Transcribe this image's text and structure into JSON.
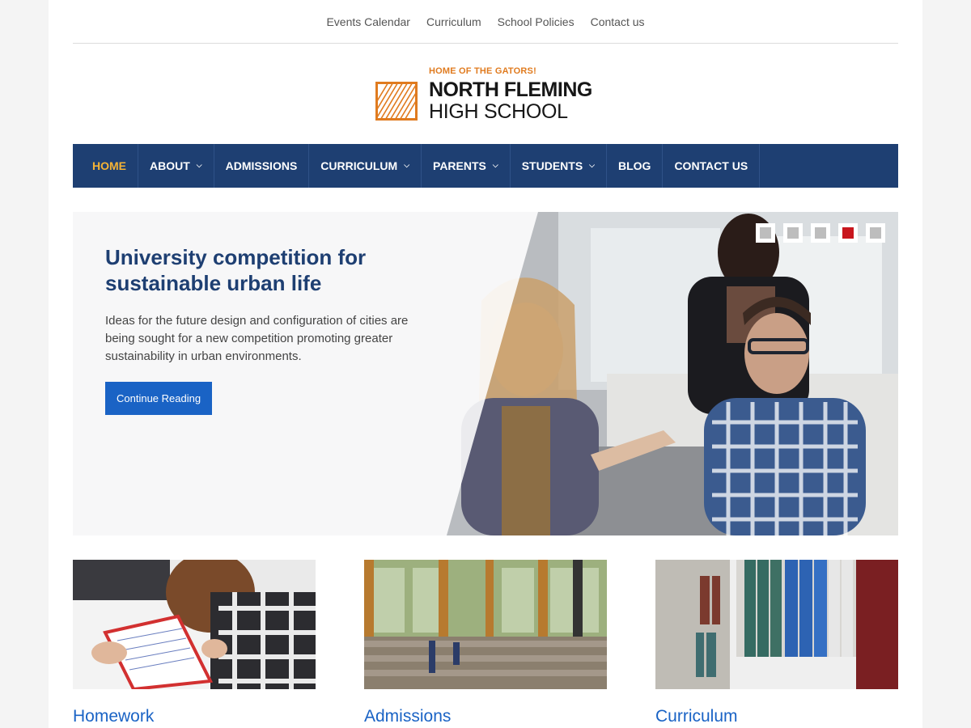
{
  "topnav": {
    "links": [
      "Events Calendar",
      "Curriculum",
      "School Policies",
      "Contact us"
    ]
  },
  "logo": {
    "tagline": "HOME OF THE GATORS!",
    "line1": "NORTH FLEMING",
    "line2": "HIGH SCHOOL",
    "brand_color": "#e07b1f"
  },
  "mainnav": {
    "color": "#1e3f72",
    "active_color": "#f5b335",
    "items": [
      {
        "label": "HOME",
        "dropdown": false,
        "active": true
      },
      {
        "label": "ABOUT",
        "dropdown": true
      },
      {
        "label": "ADMISSIONS",
        "dropdown": false
      },
      {
        "label": "CURRICULUM",
        "dropdown": true
      },
      {
        "label": "PARENTS",
        "dropdown": true
      },
      {
        "label": "STUDENTS",
        "dropdown": true
      },
      {
        "label": "BLOG",
        "dropdown": false
      },
      {
        "label": "CONTACT US",
        "dropdown": false
      }
    ]
  },
  "hero": {
    "title": "University competition for sustainable urban life",
    "text": "Ideas for the future design and configuration of cities are being sought for a new competition promoting greater sustainability in urban environments.",
    "button": "Continue Reading",
    "slide_count": 5,
    "active_slide": 4
  },
  "cards": [
    {
      "title": "Homework",
      "image": "student-writing-photo"
    },
    {
      "title": "Admissions",
      "image": "school-atrium-photo"
    },
    {
      "title": "Curriculum",
      "image": "library-books-photo"
    }
  ]
}
